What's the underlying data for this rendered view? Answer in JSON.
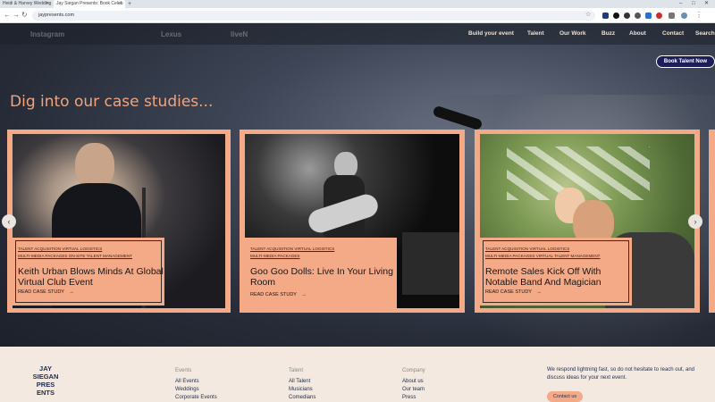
{
  "browser": {
    "tabs": [
      {
        "label": "Heidi & Harvey Wedding"
      },
      {
        "label": "Jay Siegan Presents: Book Celeb"
      }
    ],
    "new_tab_label": "+",
    "url": "jaypresents.com"
  },
  "site": {
    "logos": [
      "Instagram",
      "Lexus",
      "liveN"
    ],
    "nav": [
      "Build your event",
      "Talent",
      "Our Work",
      "Buzz",
      "About",
      "Contact",
      "Search"
    ],
    "book_button": "Book Talent Now",
    "heading": "Dig into our case studies...",
    "cards": [
      {
        "tags_line1": "TALENT ACQUISITION  VIRTUAL LOGISTICS",
        "tags_line2": "MULTI-MEDIA PACKAGES  ON-SITE TALENT MANAGEMENT",
        "title": "Keith Urban Blows Minds At Global Virtual Club Event",
        "cta": "READ CASE STUDY"
      },
      {
        "tags_line1": "TALENT ACQUISITION  VIRTUAL LOGISTICS",
        "tags_line2": "MULTI-MEDIA PACKAGES",
        "title": "Goo Goo Dolls: Live In Your Living Room",
        "cta": "READ CASE STUDY"
      },
      {
        "tags_line1": "TALENT ACQUISITION  VIRTUAL LOGISTICS",
        "tags_line2": "MULTI-MEDIA PACKAGES  VIRTUAL TALENT MANAGEMENT",
        "title": "Remote Sales Kick Off With Notable Band And Magician",
        "cta": "READ CASE STUDY"
      }
    ],
    "carousel_prev": "‹",
    "carousel_next": "›",
    "arrow_glyph": "→"
  },
  "footer": {
    "logo_lines": [
      "JAY",
      "SIEGAN",
      "PRES",
      "ENTS"
    ],
    "columns": [
      {
        "heading": "Events",
        "links": [
          "All Events",
          "Weddings",
          "Corporate Events"
        ]
      },
      {
        "heading": "Talent",
        "links": [
          "All Talent",
          "Musicians",
          "Comedians"
        ]
      },
      {
        "heading": "Company",
        "links": [
          "About us",
          "Our team",
          "Press"
        ]
      }
    ],
    "note": "We respond lightning fast, so do not hesitate to reach out, and discuss ideas for your next event.",
    "contact_button": "Contact us"
  },
  "colors": {
    "accent": "#f4a987",
    "heading": "#f0a57e",
    "navy": "#1e1d5a",
    "footer_bg": "#f3e9e0"
  }
}
